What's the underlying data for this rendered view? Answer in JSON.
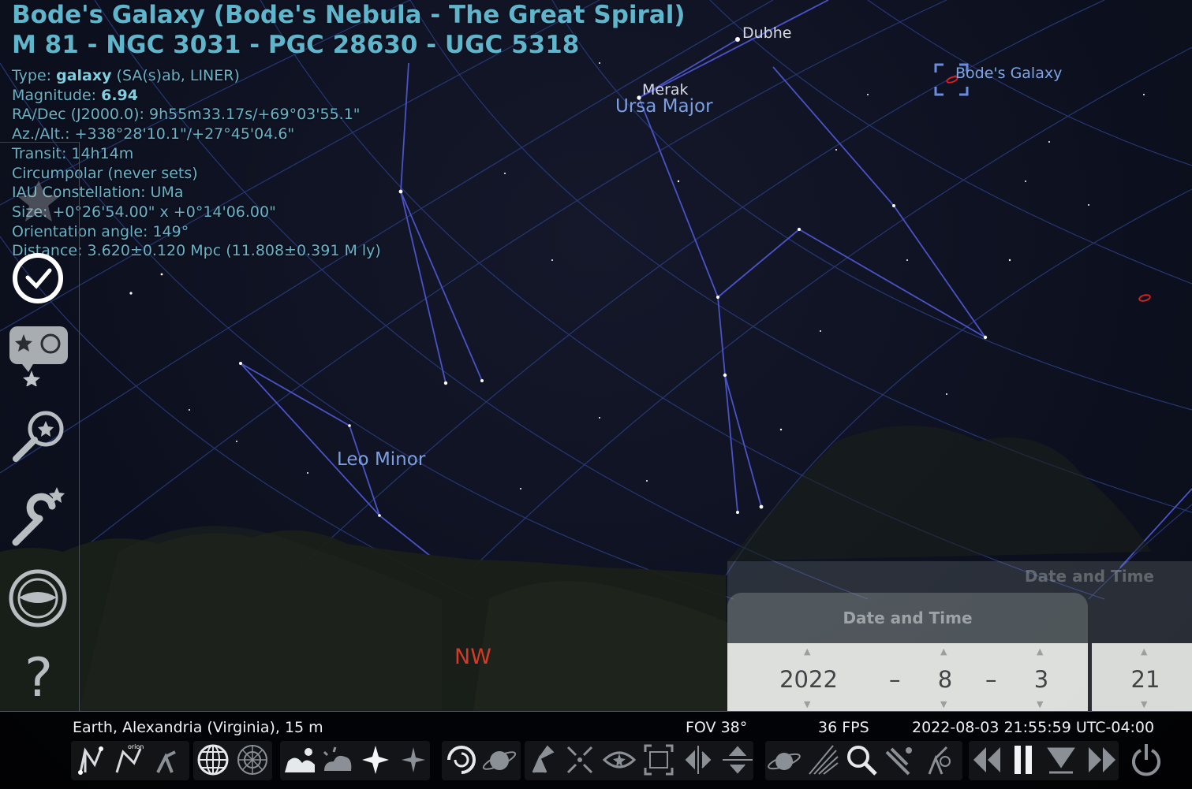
{
  "object_info": {
    "title_line1": "Bode's Galaxy (Bode's Nebula - The Great Spiral)",
    "title_line2": "M 81 - NGC 3031 - PGC 28630 - UGC 5318",
    "type_label": "Type: ",
    "type_value": "galaxy",
    "type_detail": " (SA(s)ab, LINER)",
    "magnitude_label": "Magnitude: ",
    "magnitude_value": "6.94",
    "radec": "RA/Dec (J2000.0): 9h55m33.17s/+69°03'55.1\"",
    "azalt": "Az./Alt.: +338°28'10.1\"/+27°45'04.6\"",
    "transit": "Transit: 14h14m",
    "circumpolar": "Circumpolar (never sets)",
    "constellation": "IAU Constellation: UMa",
    "size": "Size: +0°26'54.00\" x +0°14'06.00\"",
    "orientation": "Orientation angle: 149°",
    "distance": "Distance: 3.620±0.120 Mpc (11.808±0.391 M ly)"
  },
  "sky_labels": {
    "dubhe": "Dubhe",
    "merak": "Merak",
    "ursa_major": "Ursa Major",
    "leo_minor": "Leo Minor",
    "bodes_galaxy": "Bode's Galaxy",
    "cardinal": "NW"
  },
  "date_time_window": {
    "back_title": "Date and Time",
    "title": "Date and Time",
    "year": "2022",
    "month": "8",
    "day": "3",
    "hour": "21",
    "separator": "–"
  },
  "status_bar": {
    "location": "Earth, Alexandria (Virginia), 15 m",
    "fov": "FOV 38°",
    "fps": "36 FPS",
    "datetime": "2022-08-03 21:55:59 UTC-04:00"
  },
  "sidebar": {
    "items": [
      "location-icon",
      "clock-icon",
      "sky-and-viewing-options-icon",
      "search-icon",
      "configuration-icon",
      "astronomical-calculations-icon",
      "help-icon"
    ],
    "help_glyph": "?"
  },
  "toolbar": {
    "items": [
      "constellation-lines-icon",
      "constellation-art-icon",
      "constellation-labels-icon",
      "equatorial-grid-icon",
      "azimuthal-grid-icon",
      "ground-icon",
      "atmosphere-icon",
      "cardinal-points-icon",
      "nebulae-icon",
      "planets-icon",
      "deep-sky-icon",
      "telescope-mount-icon",
      "center-selected-icon",
      "night-mode-icon",
      "full-screen-icon",
      "flip-horizontal-icon",
      "flip-vertical-icon",
      "satellites-icon",
      "meteor-showers-icon",
      "search-tool-icon",
      "ocular-icon",
      "telescope-control-icon",
      "decrease-time-speed-icon",
      "pause-icon",
      "real-time-icon",
      "increase-time-speed-icon",
      "quit-icon"
    ]
  },
  "colors": {
    "info_text": "#6ab3c7",
    "constellation_line": "#4a52c8",
    "grid_line": "#2e3f80",
    "cardinal": "#d43a27",
    "galaxy_marker": "#e02020"
  }
}
